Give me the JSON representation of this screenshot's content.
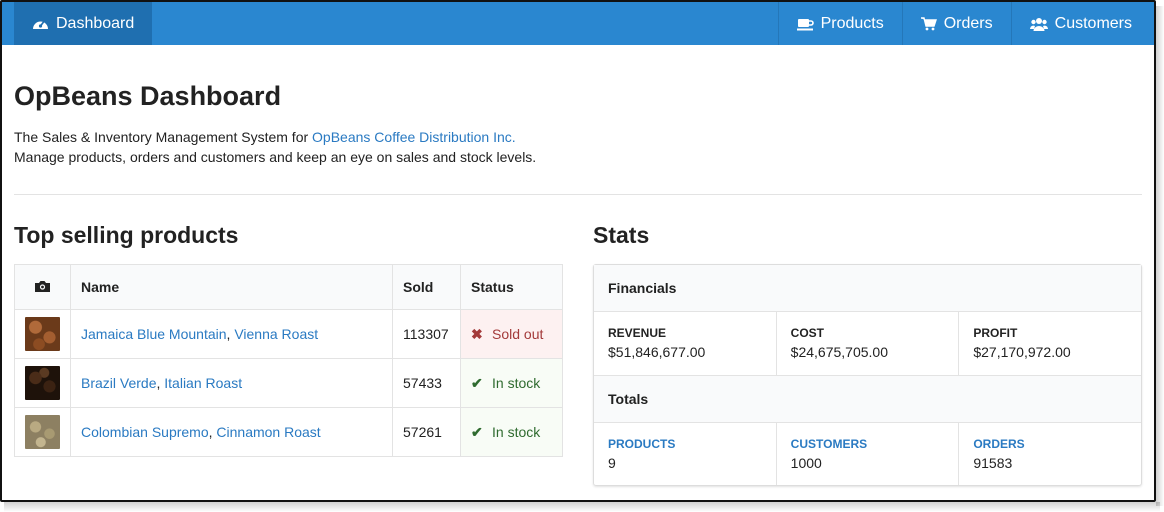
{
  "nav": {
    "dashboard": {
      "label": "Dashboard",
      "icon": "dashboard-icon"
    },
    "products": {
      "label": "Products",
      "icon": "coffee-cup-icon"
    },
    "orders": {
      "label": "Orders",
      "icon": "cart-icon"
    },
    "customers": {
      "label": "Customers",
      "icon": "users-icon"
    }
  },
  "page": {
    "title": "OpBeans Dashboard",
    "intro_prefix": "The Sales & Inventory Management System for ",
    "intro_link": "OpBeans Coffee Distribution Inc.",
    "intro_line2": "Manage products, orders and customers and keep an eye on sales and stock levels."
  },
  "top_products": {
    "heading": "Top selling products",
    "columns": {
      "photo_icon": "camera-icon",
      "name": "Name",
      "sold": "Sold",
      "status": "Status"
    },
    "rows": [
      {
        "name_a": "Jamaica Blue Mountain",
        "sep": ", ",
        "name_b": "Vienna Roast",
        "sold": "113307",
        "status": "Sold out",
        "status_type": "out"
      },
      {
        "name_a": "Brazil Verde",
        "sep": ", ",
        "name_b": "Italian Roast",
        "sold": "57433",
        "status": "In stock",
        "status_type": "in"
      },
      {
        "name_a": "Colombian Supremo",
        "sep": ", ",
        "name_b": "Cinnamon Roast",
        "sold": "57261",
        "status": "In stock",
        "status_type": "in"
      }
    ]
  },
  "stats": {
    "heading": "Stats",
    "financials": {
      "title": "Financials",
      "revenue_label": "REVENUE",
      "revenue": "$51,846,677.00",
      "cost_label": "COST",
      "cost": "$24,675,705.00",
      "profit_label": "PROFIT",
      "profit": "$27,170,972.00"
    },
    "totals": {
      "title": "Totals",
      "products_label": "PRODUCTS",
      "products": "9",
      "customers_label": "CUSTOMERS",
      "customers": "1000",
      "orders_label": "ORDERS",
      "orders": "91583"
    }
  },
  "colors": {
    "navbar": "#2a87d0",
    "link": "#2a7ac2",
    "sold_out": "#a33a3a",
    "in_stock": "#2f6b2f"
  }
}
